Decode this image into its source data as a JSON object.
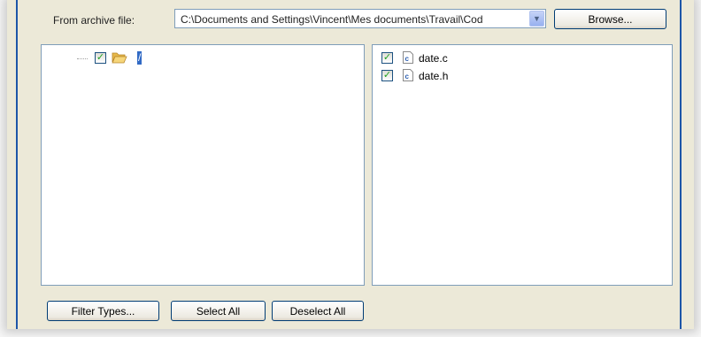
{
  "archive": {
    "label": "From archive file:",
    "path": "C:\\Documents and Settings\\Vincent\\Mes documents\\Travail\\Cod",
    "dropdown_icon": "chevron-down-icon",
    "browse_label": "Browse..."
  },
  "tree": {
    "root_label": "/",
    "root_checked": true,
    "folder_icon": "open-folder-icon"
  },
  "files": [
    {
      "name": "date.c",
      "checked": true,
      "icon": "c-file-icon"
    },
    {
      "name": "date.h",
      "checked": true,
      "icon": "c-file-icon"
    }
  ],
  "buttons": {
    "filter_types": "Filter Types...",
    "select_all": "Select All",
    "deselect_all": "Deselect All"
  },
  "colors": {
    "dialog_bg": "#ece9d8",
    "selection": "#316ac5",
    "check_green": "#21a121",
    "border_blue": "#7f9db9"
  }
}
